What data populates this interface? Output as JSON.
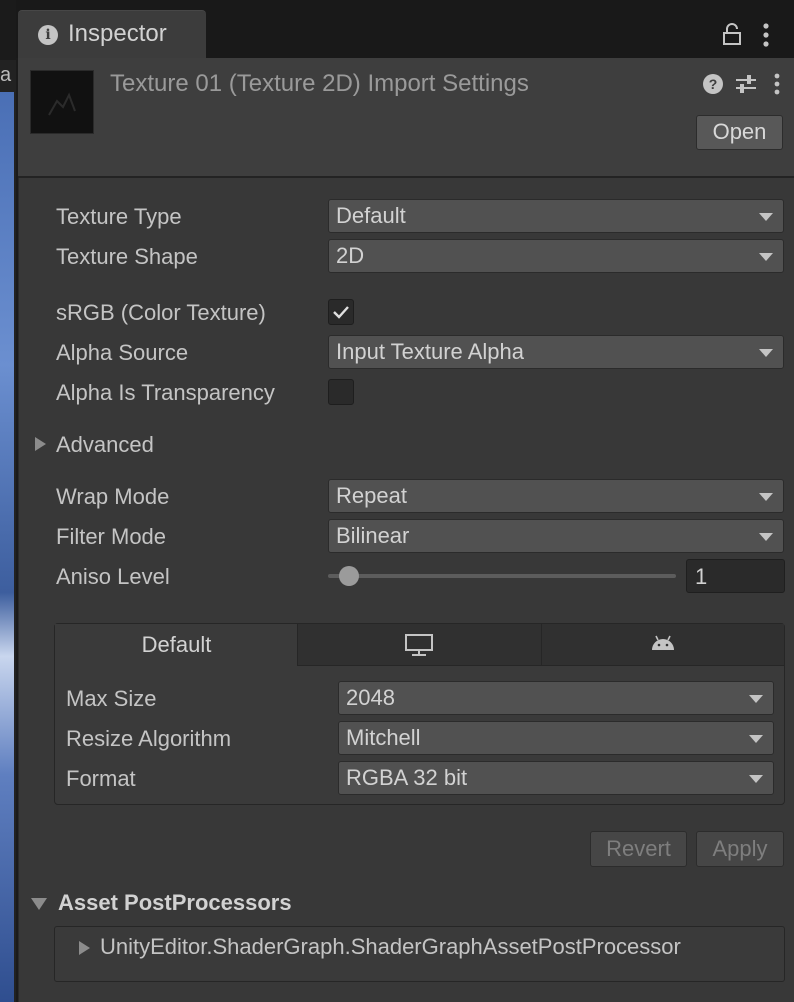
{
  "left_strip": {
    "text": "a"
  },
  "tab": {
    "icon": "info-icon",
    "title": "Inspector"
  },
  "header": {
    "title": "Texture 01 (Texture 2D) Import Settings",
    "open_label": "Open",
    "icons": [
      "help-icon",
      "preset-icon",
      "kebab-menu-icon"
    ]
  },
  "fields": {
    "texture_type": {
      "label": "Texture Type",
      "value": "Default"
    },
    "texture_shape": {
      "label": "Texture Shape",
      "value": "2D"
    },
    "srgb": {
      "label": "sRGB (Color Texture)",
      "checked": true
    },
    "alpha_source": {
      "label": "Alpha Source",
      "value": "Input Texture Alpha"
    },
    "alpha_is_transparency": {
      "label": "Alpha Is Transparency",
      "checked": false
    },
    "advanced": {
      "label": "Advanced",
      "expanded": false
    },
    "wrap_mode": {
      "label": "Wrap Mode",
      "value": "Repeat"
    },
    "filter_mode": {
      "label": "Filter Mode",
      "value": "Bilinear"
    },
    "aniso_level": {
      "label": "Aniso Level",
      "value": "1",
      "slider_fraction": 0.06
    }
  },
  "platform": {
    "tabs": [
      {
        "label": "Default",
        "icon": ""
      },
      {
        "label": "",
        "icon": "monitor-icon"
      },
      {
        "label": "",
        "icon": "android-icon"
      }
    ],
    "max_size": {
      "label": "Max Size",
      "value": "2048"
    },
    "resize_algorithm": {
      "label": "Resize Algorithm",
      "value": "Mitchell"
    },
    "format": {
      "label": "Format",
      "value": "RGBA 32 bit"
    }
  },
  "buttons": {
    "revert": "Revert",
    "apply": "Apply"
  },
  "asset_postprocessors": {
    "title": "Asset PostProcessors",
    "items": [
      "UnityEditor.ShaderGraph.ShaderGraphAssetPostProcessor"
    ]
  },
  "colors": {
    "panel": "#383838",
    "header": "#3e3e3e",
    "dropdown": "#515151",
    "text": "#c4c4c4"
  }
}
